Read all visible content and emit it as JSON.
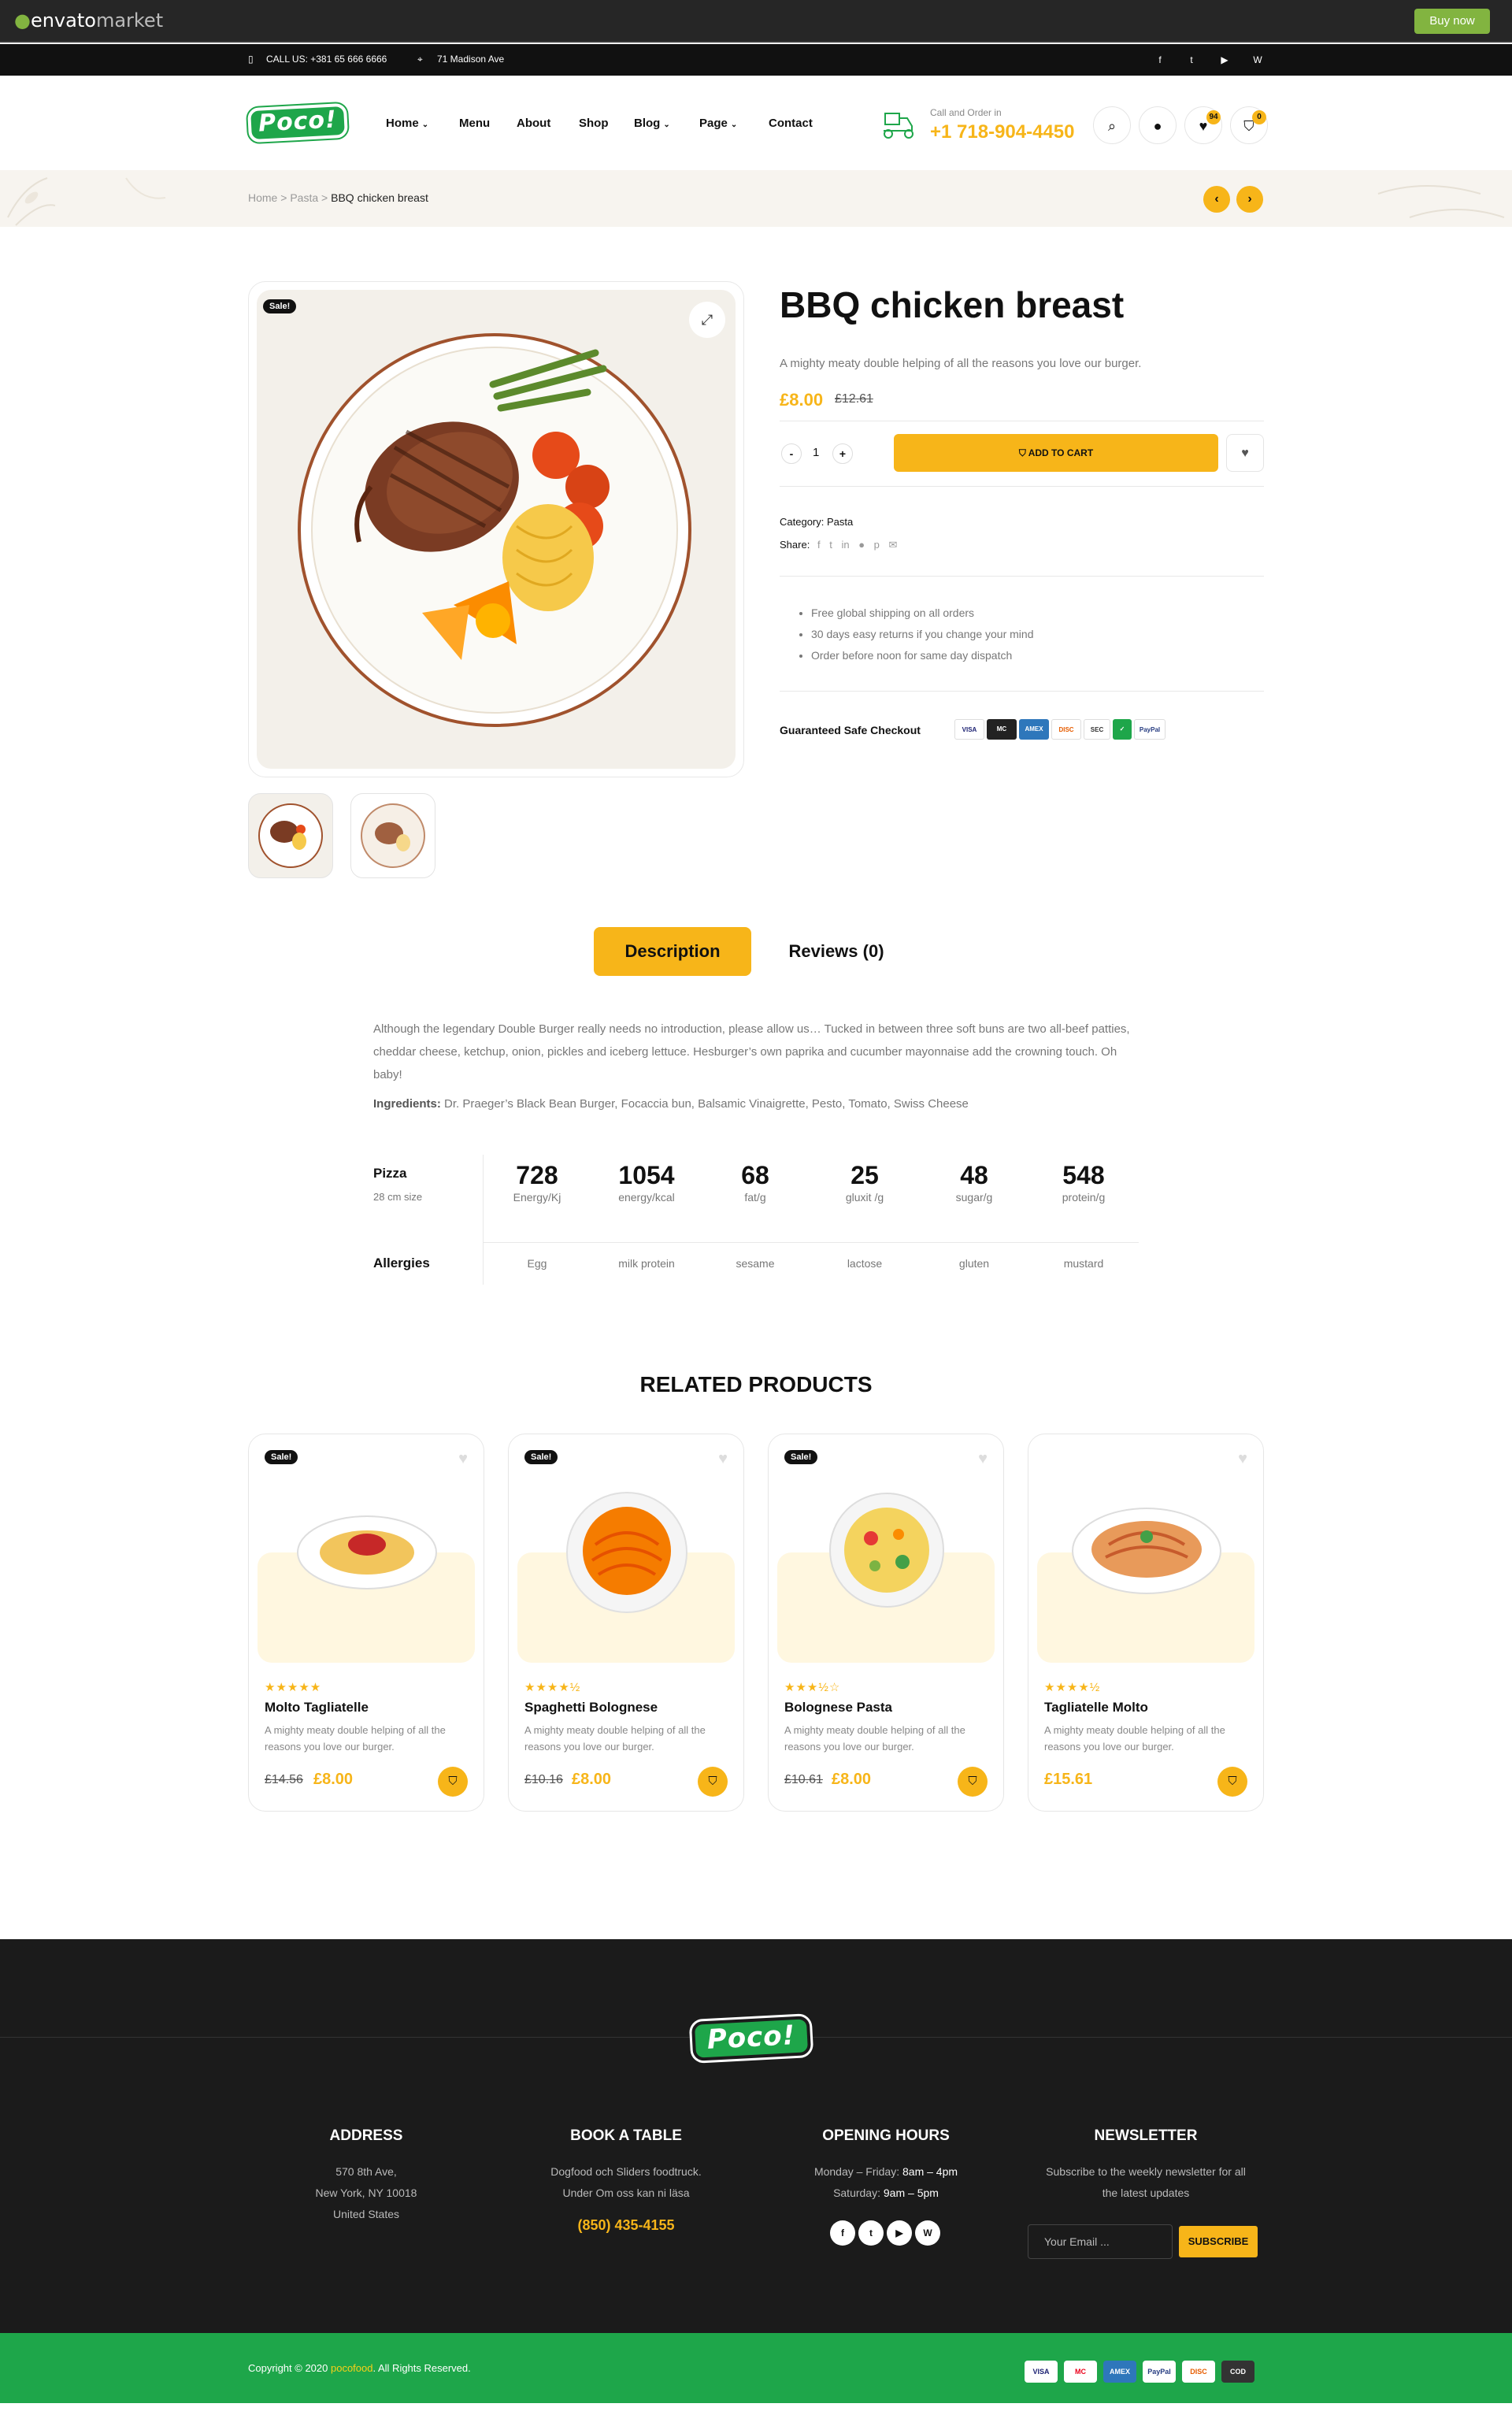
{
  "envato": {
    "logo_text": "envato",
    "logo_suffix": "market",
    "buy_label": "Buy now"
  },
  "topbar": {
    "phone": "CALL US: +381 65 666 6666",
    "address": "71 Madison Ave",
    "socials": [
      "facebook-icon",
      "twitter-icon",
      "youtube-icon",
      "wordpress-icon"
    ]
  },
  "header": {
    "brand": "Poco!",
    "nav": [
      {
        "label": "Home",
        "has_dropdown": true
      },
      {
        "label": "Menu",
        "has_dropdown": false
      },
      {
        "label": "About",
        "has_dropdown": false
      },
      {
        "label": "Shop",
        "has_dropdown": false
      },
      {
        "label": "Blog",
        "has_dropdown": true
      },
      {
        "label": "Page",
        "has_dropdown": true
      },
      {
        "label": "Contact",
        "has_dropdown": false
      }
    ],
    "call_small": "Call and Order in",
    "call_number": "+1 718-904-4450",
    "wishlist_count": "94",
    "cart_count": "0"
  },
  "breadcrumb": {
    "items": [
      "Home",
      "Pasta"
    ],
    "current": "BBQ chicken breast",
    "separator": ">"
  },
  "product": {
    "title": "BBQ chicken breast",
    "short_desc": "A mighty meaty double helping of all the reasons you love our burger.",
    "price": "£8.00",
    "old_price": "£12.61",
    "sale_badge": "Sale!",
    "qty": "1",
    "add_to_cart": "ADD TO CART",
    "category_label": "Category:",
    "category_value": "Pasta",
    "share_label": "Share:",
    "bullets": [
      "Free global shipping on all orders",
      "30 days easy returns if you change your mind",
      "Order before noon for same day dispatch"
    ],
    "safe_checkout": "Guaranteed Safe Checkout",
    "payment_cards": [
      "VISA",
      "MC",
      "AMEX",
      "DISC",
      "SEC",
      "✓",
      "PayPal"
    ]
  },
  "tabs": {
    "description": "Description",
    "reviews": "Reviews (0)"
  },
  "description": {
    "text": "Although the legendary Double Burger really needs no introduction, please allow us… Tucked in between three soft buns are two all-beef patties, cheddar cheese, ketchup, onion, pickles and iceberg lettuce. Hesburger’s own paprika and cucumber mayonnaise add the crowning touch. Oh baby!",
    "ingredients_label": "Ingredients:",
    "ingredients": "Dr. Praeger’s Black Bean Burger, Focaccia bun, Balsamic Vinaigrette, Pesto, Tomato, Swiss Cheese"
  },
  "nutrition": {
    "title": "Pizza",
    "subtitle": "28 cm size",
    "items": [
      {
        "value": "728",
        "label": "Energy/Kj"
      },
      {
        "value": "1054",
        "label": "energy/kcal"
      },
      {
        "value": "68",
        "label": "fat/g"
      },
      {
        "value": "25",
        "label": "gluxit /g"
      },
      {
        "value": "48",
        "label": "sugar/g"
      },
      {
        "value": "548",
        "label": "protein/g"
      }
    ],
    "allergies_title": "Allergies",
    "allergies": [
      "Egg",
      "milk protein",
      "sesame",
      "lactose",
      "gluten",
      "mustard"
    ]
  },
  "related": {
    "title": "RELATED PRODUCTS",
    "products": [
      {
        "name": "Molto Tagliatelle",
        "desc": "A mighty meaty double helping of all the reasons you love our burger.",
        "old_price": "£14.56",
        "price": "£8.00",
        "sale": "Sale!",
        "stars": "★★★★★",
        "rating": 5
      },
      {
        "name": "Spaghetti Bolognese",
        "desc": "A mighty meaty double helping of all the reasons you love our burger.",
        "old_price": "£10.16",
        "price": "£8.00",
        "sale": "Sale!",
        "stars": "★★★★½",
        "rating": 4.5
      },
      {
        "name": "Bolognese Pasta",
        "desc": "A mighty meaty double helping of all the reasons you love our burger.",
        "old_price": "£10.61",
        "price": "£8.00",
        "sale": "Sale!",
        "stars": "★★★½☆",
        "rating": 3.5
      },
      {
        "name": "Tagliatelle Molto",
        "desc": "A mighty meaty double helping of all the reasons you love our burger.",
        "old_price": "",
        "price": "£15.61",
        "sale": "",
        "stars": "★★★★½",
        "rating": 4.5
      }
    ]
  },
  "footer": {
    "brand": "Poco!",
    "address_title": "ADDRESS",
    "address_lines": [
      "570 8th Ave,",
      "New York, NY 10018",
      "United States"
    ],
    "book_title": "BOOK A TABLE",
    "book_lines": [
      "Dogfood och Sliders foodtruck.",
      "Under Om oss kan ni läsa"
    ],
    "book_phone": "(850) 435-4155",
    "hours_title": "OPENING HOURS",
    "hours": [
      {
        "day": "Monday – Friday:",
        "time": "8am – 4pm"
      },
      {
        "day": "Saturday:",
        "time": "9am – 5pm"
      }
    ],
    "newsletter_title": "NEWSLETTER",
    "newsletter_text": [
      "Subscribe to the weekly newsletter for all",
      "the latest updates"
    ],
    "email_placeholder": "Your Email ...",
    "subscribe_label": "SUBSCRIBE",
    "copyright_pre": "Copyright © 2020 ",
    "copyright_brand": "pocofood",
    "copyright_post": ". All Rights Reserved.",
    "payments": [
      "VISA",
      "MC",
      "AMEX",
      "PayPal",
      "DISC",
      "COD"
    ]
  },
  "colors": {
    "accent": "#f7b519",
    "brand_green": "#1ea64a",
    "dark": "#1b1b1b",
    "envato_green": "#82b440"
  }
}
